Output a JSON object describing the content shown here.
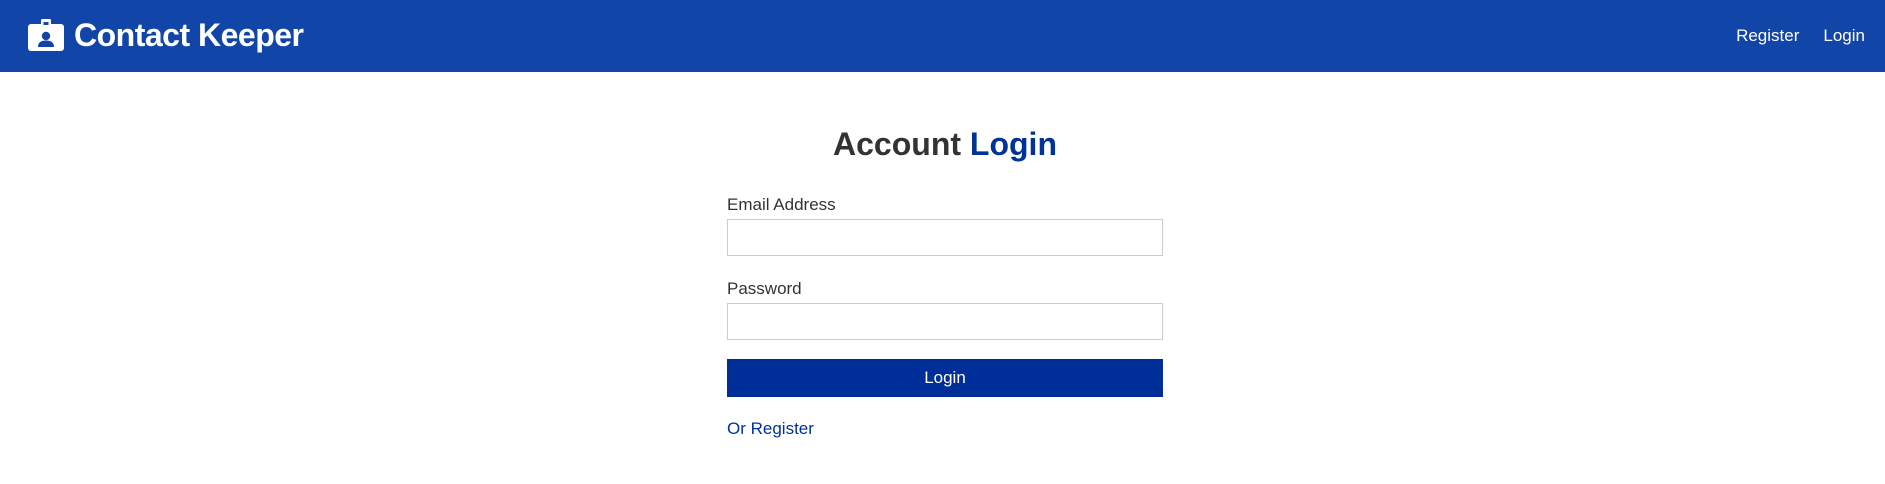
{
  "navbar": {
    "title": "Contact Keeper",
    "icon": "id-badge-icon",
    "links": [
      {
        "label": "Register"
      },
      {
        "label": "Login"
      }
    ],
    "background_color": "#1245a8"
  },
  "page": {
    "title_part1": "Account",
    "title_part2": "Login",
    "accent_color": "#003399"
  },
  "form": {
    "email_label": "Email Address",
    "email_value": "",
    "password_label": "Password",
    "password_value": "",
    "submit_label": "Login",
    "register_link": "Or Register"
  }
}
